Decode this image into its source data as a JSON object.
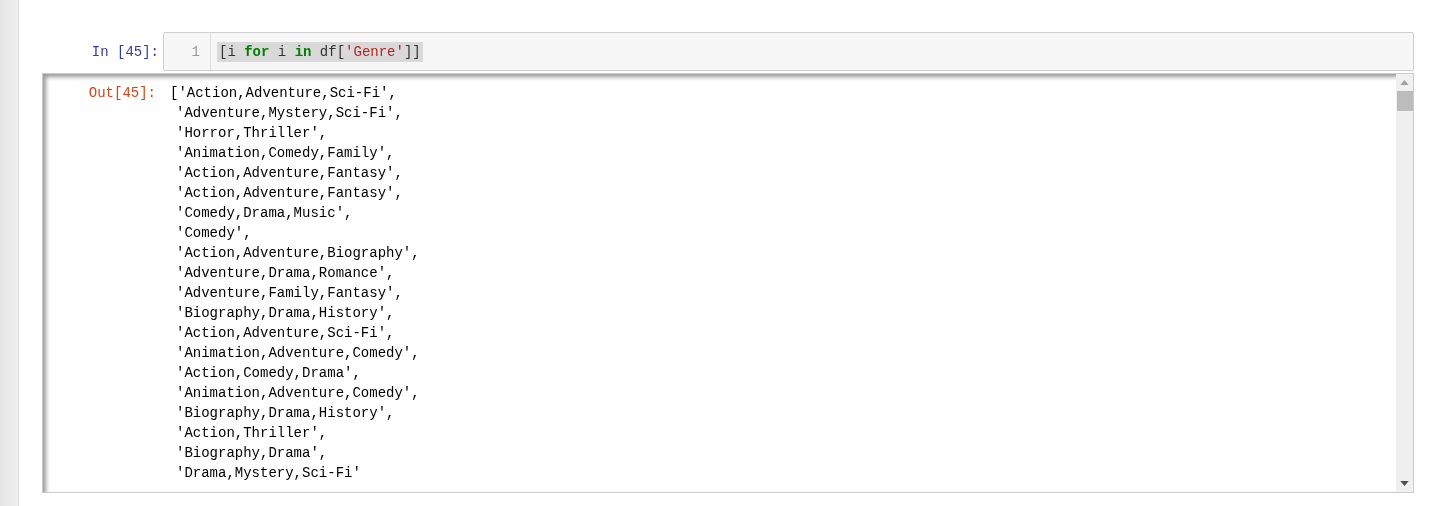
{
  "input_cell": {
    "prompt": "In [45]:",
    "line_number": "1",
    "code_tokens": [
      {
        "kind": "plain",
        "text": "[i "
      },
      {
        "kind": "keyword",
        "text": "for"
      },
      {
        "kind": "plain",
        "text": " i "
      },
      {
        "kind": "keyword",
        "text": "in"
      },
      {
        "kind": "plain",
        "text": " df["
      },
      {
        "kind": "string",
        "text": "'Genre'"
      },
      {
        "kind": "plain",
        "text": "]]"
      }
    ]
  },
  "output_cell": {
    "prompt": "Out[45]:",
    "lines": [
      "['Action,Adventure,Sci-Fi',",
      "'Adventure,Mystery,Sci-Fi',",
      "'Horror,Thriller',",
      "'Animation,Comedy,Family',",
      "'Action,Adventure,Fantasy',",
      "'Action,Adventure,Fantasy',",
      "'Comedy,Drama,Music',",
      "'Comedy',",
      "'Action,Adventure,Biography',",
      "'Adventure,Drama,Romance',",
      "'Adventure,Family,Fantasy',",
      "'Biography,Drama,History',",
      "'Action,Adventure,Sci-Fi',",
      "'Animation,Adventure,Comedy',",
      "'Action,Comedy,Drama',",
      "'Animation,Adventure,Comedy',",
      "'Biography,Drama,History',",
      "'Action,Thriller',",
      "'Biography,Drama',",
      "'Drama,Mystery,Sci-Fi'"
    ]
  }
}
